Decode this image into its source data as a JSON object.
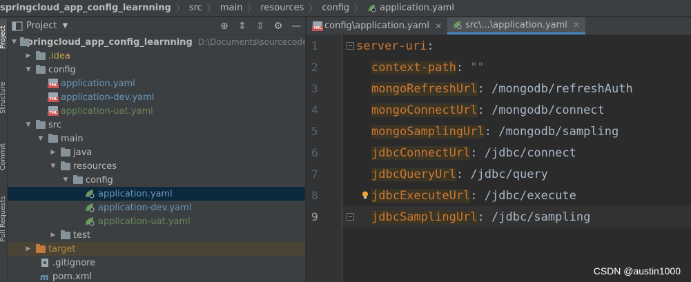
{
  "breadcrumb": {
    "items": [
      "springcloud_app_config_learnning",
      "src",
      "main",
      "resources",
      "config",
      "application.yaml"
    ]
  },
  "side_strip": {
    "labels": [
      "Project",
      "Structure",
      "Commit",
      "Pull Requests"
    ]
  },
  "project_panel": {
    "title": "Project",
    "root_name": "springcloud_app_config_learnning",
    "root_path": "D:\\Documents\\sourcecode\\git",
    "tree": [
      {
        "label": ".idea"
      },
      {
        "label": "config"
      },
      {
        "label": "application.yaml"
      },
      {
        "label": "application-dev.yaml"
      },
      {
        "label": "application-uat.yaml"
      },
      {
        "label": "src"
      },
      {
        "label": "main"
      },
      {
        "label": "java"
      },
      {
        "label": "resources"
      },
      {
        "label": "config"
      },
      {
        "label": "application.yaml"
      },
      {
        "label": "application-dev.yaml"
      },
      {
        "label": "application-uat.yaml"
      },
      {
        "label": "test"
      },
      {
        "label": "target"
      },
      {
        "label": ".gitignore"
      },
      {
        "label": "pom.xml"
      }
    ]
  },
  "editor": {
    "tabs": [
      {
        "label": "config\\application.yaml",
        "active": false
      },
      {
        "label": "src\\...\\application.yaml",
        "active": true
      }
    ],
    "current_line": 9,
    "lines": [
      {
        "num": "1",
        "key": "server-uri",
        "sep": ":",
        "value": ""
      },
      {
        "num": "2",
        "key": "context-path",
        "sep": ": ",
        "value": "\"\""
      },
      {
        "num": "3",
        "key": "mongoRefreshUrl",
        "sep": ": ",
        "value": "/mongodb/refreshAuth"
      },
      {
        "num": "4",
        "key": "mongoConnectUrl",
        "sep": ": ",
        "value": "/mongodb/connect"
      },
      {
        "num": "5",
        "key": "mongoSamplingUrl",
        "sep": ": ",
        "value": "/mongodb/sampling"
      },
      {
        "num": "6",
        "key": "jdbcConnectUrl",
        "sep": ": ",
        "value": "/jdbc/connect"
      },
      {
        "num": "7",
        "key": "jdbcQueryUrl",
        "sep": ": ",
        "value": "/jdbc/query"
      },
      {
        "num": "8",
        "key": "jdbcExecuteUrl",
        "sep": ": ",
        "value": "/jdbc/execute"
      },
      {
        "num": "9",
        "key": "jdbcSamplingUrl",
        "sep": ": ",
        "value": "/jdbc/sampling"
      }
    ]
  },
  "watermark": "CSDN @austin1000",
  "colors": {
    "keyword": "#cc7832",
    "value": "#a9b7c6",
    "string": "#6a8759",
    "selection": "#0d293e",
    "active_tab_underline": "#4a88c7"
  }
}
